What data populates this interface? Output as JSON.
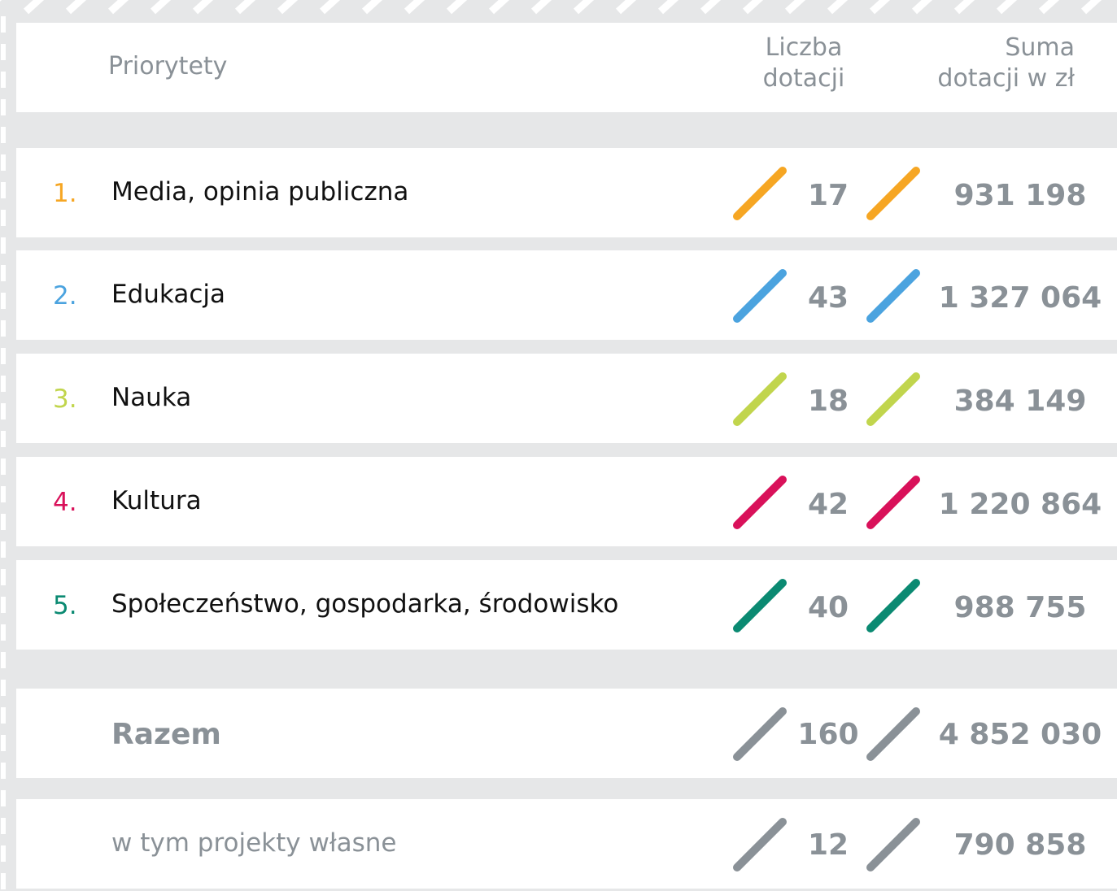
{
  "header": {
    "priorities": "Priorytety",
    "count_line1": "Liczba",
    "count_line2": "dotacji",
    "sum_line1": "Suma",
    "sum_line2": "dotacji w zł"
  },
  "colors": {
    "media": "#f6a623",
    "edukacja": "#4ba3df",
    "nauka": "#c1d54d",
    "kultura": "#d9115a",
    "spoleczenstwo": "#0b8a72",
    "total": "#8a9197"
  },
  "rows": [
    {
      "num": "1.",
      "label": "Media, opinia publiczna",
      "count": "17",
      "sum": "931 198",
      "color": "#f6a623"
    },
    {
      "num": "2.",
      "label": "Edukacja",
      "count": "43",
      "sum": "1 327 064",
      "color": "#4ba3df"
    },
    {
      "num": "3.",
      "label": "Nauka",
      "count": "18",
      "sum": "384 149",
      "color": "#c1d54d"
    },
    {
      "num": "4.",
      "label": "Kultura",
      "count": "42",
      "sum": "1 220 864",
      "color": "#d9115a"
    },
    {
      "num": "5.",
      "label": "Społeczeństwo, gospodarka, środowisko",
      "count": "40",
      "sum": "988 755",
      "color": "#0b8a72"
    }
  ],
  "total": {
    "label": "Razem",
    "count": "160",
    "sum": "4 852 030"
  },
  "own_projects": {
    "label": "w tym projekty własne",
    "count": "12",
    "sum": "790 858"
  },
  "chart_data": {
    "type": "table",
    "columns": [
      "Priorytety",
      "Liczba dotacji",
      "Suma dotacji w zł"
    ],
    "categories": [
      "Media, opinia publiczna",
      "Edukacja",
      "Nauka",
      "Kultura",
      "Społeczeństwo, gospodarka, środowisko"
    ],
    "series": [
      {
        "name": "Liczba dotacji",
        "values": [
          17,
          43,
          18,
          42,
          40
        ]
      },
      {
        "name": "Suma dotacji w zł",
        "values": [
          931198,
          1327064,
          384149,
          1220864,
          988755
        ]
      }
    ],
    "totals": {
      "Razem": [
        160,
        4852030
      ],
      "w tym projekty własne": [
        12,
        790858
      ]
    }
  }
}
